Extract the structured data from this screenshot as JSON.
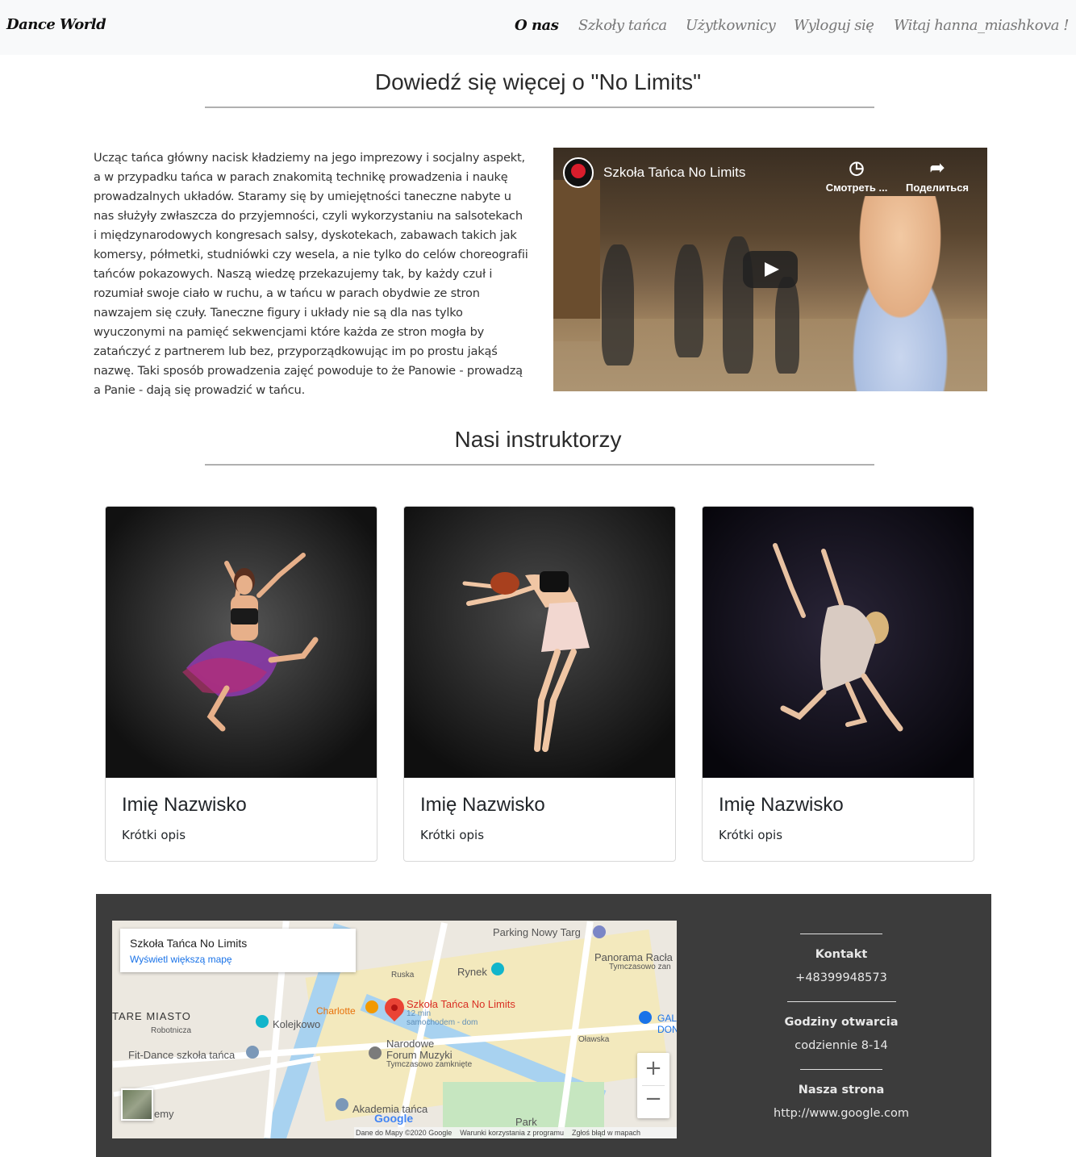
{
  "nav": {
    "brand": "Dance World",
    "items": [
      "O nas",
      "Szkoły tańca",
      "Użytkownicy",
      "Wyloguj się",
      "Witaj hanna_miashkova !"
    ],
    "active": "O nas"
  },
  "about": {
    "title": "Dowiedź się więcej o \"No Limits\"",
    "text": "Ucząc tańca główny nacisk kładziemy na jego imprezowy i socjalny aspekt, a w przypadku tańca w parach znakomitą technikę prowadzenia i naukę prowadzalnych układów. Staramy się by umiejętności taneczne nabyte u nas służyły zwłaszcza do przyjemności, czyli wykorzystaniu na salsotekach i międzynarodowych kongresach salsy, dyskotekach, zabawach takich jak komersy, półmetki, studniówki czy wesela, a nie tylko do celów choreografii tańców pokazowych. Naszą wiedzę przekazujemy tak, by każdy czuł i rozumiał swoje ciało w ruchu, a w tańcu w parach obydwie ze stron nawzajem się czuły. Taneczne figury i układy nie są dla nas tylko wyuczonymi na pamięć sekwencjami które każda ze stron mogła by zatańczyć z partnerem lub bez, przyporządkowując im po prostu jakąś nazwę. Taki sposób prowadzenia zajęć powoduje to że Panowie - prowadzą a Panie - dają się prowadzić w tańcu."
  },
  "video": {
    "title": "Szkoła Tańca No Limits",
    "watch_later": "Смотреть ...",
    "share": "Поделиться"
  },
  "instructors": {
    "title": "Nasi instruktorzy",
    "cards": [
      {
        "name": "Imię Nazwisko",
        "desc": "Krótki opis"
      },
      {
        "name": "Imię Nazwisko",
        "desc": "Krótki opis"
      },
      {
        "name": "Imię Nazwisko",
        "desc": "Krótki opis"
      }
    ]
  },
  "map": {
    "place": "Szkoła Tańca No Limits",
    "bigger_map": "Wyświetl większą mapę",
    "labels": {
      "parking": "Parking Nowy Targ",
      "rynek": "Rynek",
      "panorama": "Panorama Racła",
      "temp_closed": "Tymczasowo zan",
      "charlotte": "Charlotte",
      "stare_miasto": "TARE MIASTO",
      "kolejkowo": "Kolejkowo",
      "robotnicza": "Robotnicza",
      "fit_dance": "Fit-Dance szkoła tańca",
      "nfm1": "Narodowe",
      "nfm2": "Forum Muzyki",
      "nfm3": "Tymczasowo zamknięte",
      "akademia": "Akademia tańca",
      "park": "Park",
      "olawska": "Oławska",
      "emy": "emy",
      "ruska": "Ruska",
      "pin_title": "Szkoła Tańca No Limits",
      "pin_sub1": "12 min",
      "pin_sub2": "samochodem - dom",
      "ga": "GAL",
      "do": "DON"
    },
    "google": "Google",
    "attribution": [
      "Dane do Mapy ©2020 Google",
      "Warunki korzystania z programu",
      "Zgłoś błąd w mapach"
    ]
  },
  "contact": {
    "kontakt_label": "Kontakt",
    "phone": "+48399948573",
    "hours_label": "Godziny otwarcia",
    "hours": "codziennie 8-14",
    "site_label": "Nasza strona",
    "site": "http://www.google.com"
  }
}
